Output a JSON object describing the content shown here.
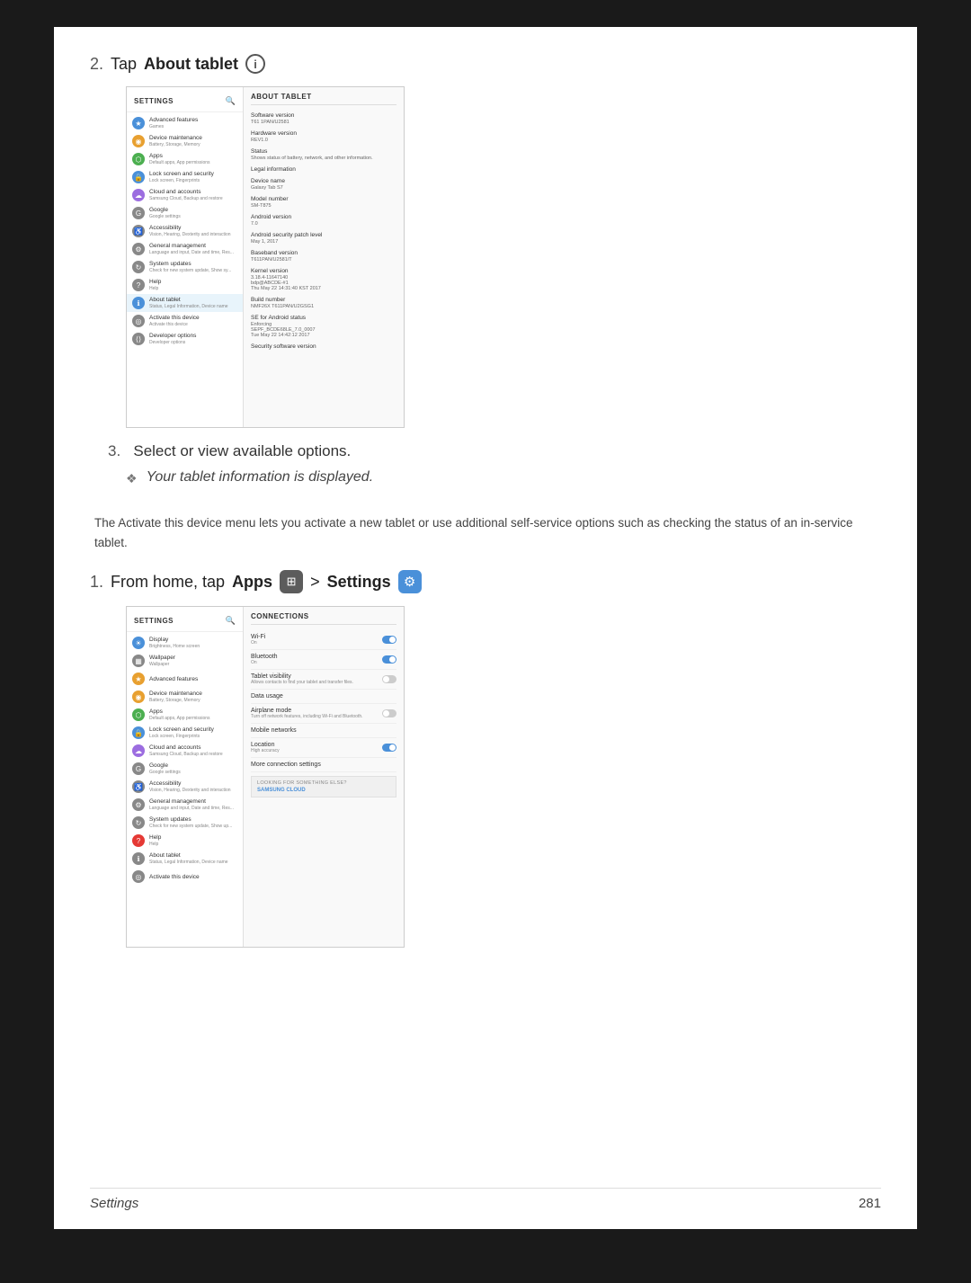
{
  "page": {
    "background": "#1a1a1a",
    "content_background": "#fff"
  },
  "section1": {
    "step_number": "2.",
    "step_prefix": "Tap ",
    "step_bold": "About tablet",
    "info_icon": "i"
  },
  "screenshot1": {
    "settings_title": "SETTINGS",
    "about_tablet_title": "ABOUT TABLET",
    "left_items": [
      {
        "label": "Advanced features",
        "sublabel": "Games",
        "icon": "★",
        "color": "blue"
      },
      {
        "label": "Device maintenance",
        "sublabel": "Battery, Storage, Memory",
        "icon": "◉",
        "color": "orange"
      },
      {
        "label": "Apps",
        "sublabel": "Default apps, App permissions",
        "icon": "⬡",
        "color": "green"
      },
      {
        "label": "Lock screen and security",
        "sublabel": "Lock screen, Fingerprints",
        "icon": "🔒",
        "color": "blue"
      },
      {
        "label": "Cloud and accounts",
        "sublabel": "Samsung Cloud, Backup and restore",
        "icon": "☁",
        "color": "purple"
      },
      {
        "label": "Google",
        "sublabel": "Google settings",
        "icon": "G",
        "color": "gray"
      },
      {
        "label": "Accessibility",
        "sublabel": "Vision, Hearing, Dexterity and interaction",
        "icon": "♿",
        "color": "gray"
      },
      {
        "label": "General management",
        "sublabel": "Language and input, Date and time, Res...",
        "icon": "⚙",
        "color": "gray"
      },
      {
        "label": "System updates",
        "sublabel": "Check for new system update, Show sy...",
        "icon": "↻",
        "color": "gray"
      },
      {
        "label": "Help",
        "sublabel": "Help",
        "icon": "?",
        "color": "gray"
      },
      {
        "label": "About tablet",
        "sublabel": "Status, Legal Information, Device name",
        "icon": "ℹ",
        "color": "blue",
        "active": true
      },
      {
        "label": "Activate this device",
        "sublabel": "Activate this device",
        "icon": "◎",
        "color": "gray"
      },
      {
        "label": "Developer options",
        "sublabel": "Developer options",
        "icon": "⟨⟩",
        "color": "gray"
      }
    ],
    "right_items": [
      {
        "label": "Software version",
        "value": "T61 1PAN/U2581"
      },
      {
        "label": "Hardware version",
        "value": "REV1.0"
      },
      {
        "label": "Status",
        "value": "Shows status of battery, network, and other information."
      },
      {
        "label": "Legal information",
        "value": ""
      },
      {
        "label": "Device name",
        "value": "Galaxy Tab S7"
      },
      {
        "label": "Model number",
        "value": "SM-T875"
      },
      {
        "label": "Android version",
        "value": "7.0"
      },
      {
        "label": "Android security patch level",
        "value": "May 1, 2017"
      },
      {
        "label": "Baseband version",
        "value": "T611PAN/U2581/T"
      },
      {
        "label": "Kernel version",
        "value": "3.18.4-11647140\nbdp@ABCDEFG-#1\nThu May 22 14:31:40 KST 2017"
      },
      {
        "label": "Build number",
        "value": "NMF26X T611PAN/U2GSG1"
      },
      {
        "label": "SE for Android status",
        "value": "Enforcing\nSEPF_BCDE68LE_7.0_0007\nTue May 22 14:42:12 2017"
      },
      {
        "label": "Security software version",
        "value": ""
      }
    ]
  },
  "step3": {
    "text": "Select or view available options.",
    "bullet_text": "Your tablet information is displayed."
  },
  "description": {
    "text": "The Activate this device menu lets you activate a new tablet or use additional self-service options such as checking the status of an in-service tablet."
  },
  "section2": {
    "step_number": "1.",
    "step_prefix": "From home, tap ",
    "step_apps": "Apps",
    "step_arrow": " > ",
    "step_settings": "Settings"
  },
  "screenshot2": {
    "settings_title": "SETTINGS",
    "connections_title": "CONNECTIONS",
    "left_items": [
      {
        "label": "Display",
        "sublabel": "Brightness, Home screen",
        "icon": "☀",
        "color": "blue"
      },
      {
        "label": "Wallpaper",
        "sublabel": "Wallpaper",
        "icon": "▦",
        "color": "gray"
      },
      {
        "label": "Advanced features",
        "sublabel": "",
        "icon": "★",
        "color": "orange"
      },
      {
        "label": "Device maintenance",
        "sublabel": "Battery, Storage, Memory",
        "icon": "◉",
        "color": "orange"
      },
      {
        "label": "Apps",
        "sublabel": "Default apps, App permissions",
        "icon": "⬡",
        "color": "green"
      },
      {
        "label": "Lock screen and security",
        "sublabel": "Lock screen, Fingerprints",
        "icon": "🔒",
        "color": "blue"
      },
      {
        "label": "Cloud and accounts",
        "sublabel": "Samsung Cloud, Backup and restore",
        "icon": "☁",
        "color": "purple"
      },
      {
        "label": "Google",
        "sublabel": "Google settings",
        "icon": "G",
        "color": "gray"
      },
      {
        "label": "Accessibility",
        "sublabel": "Vision, Hearing, Dexterity and interaction",
        "icon": "♿",
        "color": "gray"
      },
      {
        "label": "General management",
        "sublabel": "Language and input, Date and time, Res...",
        "icon": "⚙",
        "color": "gray"
      },
      {
        "label": "System updates",
        "sublabel": "Check for new system update, Show up...",
        "icon": "↻",
        "color": "gray"
      },
      {
        "label": "Help",
        "sublabel": "Help",
        "icon": "?",
        "color": "red"
      },
      {
        "label": "About tablet",
        "sublabel": "Status, Legal Information, Device name",
        "icon": "ℹ",
        "color": "gray"
      },
      {
        "label": "Activate this device",
        "sublabel": "",
        "icon": "◎",
        "color": "gray"
      }
    ],
    "right_items": [
      {
        "label": "Wi-Fi",
        "sublabel": "On",
        "toggle": "on"
      },
      {
        "label": "Bluetooth",
        "sublabel": "On",
        "toggle": "on"
      },
      {
        "label": "Tablet visibility",
        "sublabel": "Allows contacts to find your tablet and transfer files.",
        "toggle": "off"
      },
      {
        "label": "Data usage",
        "sublabel": "",
        "toggle": null
      },
      {
        "label": "Airplane mode",
        "sublabel": "Turn off network features, including Wi-Fi and Bluetooth.",
        "toggle": "off"
      },
      {
        "label": "Mobile networks",
        "sublabel": "",
        "toggle": null
      },
      {
        "label": "Location",
        "sublabel": "High accuracy",
        "toggle": "on"
      },
      {
        "label": "More connection settings",
        "sublabel": "",
        "toggle": null
      }
    ],
    "looking_for": "LOOKING FOR SOMETHING ELSE?",
    "samsung_cloud": "SAMSUNG CLOUD"
  },
  "footer": {
    "left": "Settings",
    "right": "281"
  }
}
